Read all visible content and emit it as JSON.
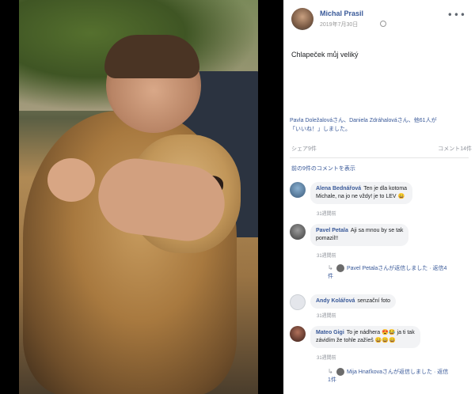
{
  "post": {
    "author": "Michal Prasil",
    "date": "2019年7月30日",
    "more_icon": "more-horizontal-icon",
    "text": "Chlapeček můj veliký",
    "likes_line1": "Pavla Doležalováさん、Daniela Zdráhalováさん、他61人が",
    "likes_line2": "「いいね！」しました。",
    "shares": "シェア9件",
    "comment_count": "コメント14件",
    "prev_comments": "前の9件のコメントを表示"
  },
  "comments": [
    {
      "name": "Alena Bednářová",
      "text_line1": "Ten je dla kotoma",
      "text_line2": "Michale, na jo ne vždy! je to LEV 😀",
      "time": "31週間前"
    },
    {
      "name": "Pavel Petala",
      "text_line1": "Aji sa mnou by se tak",
      "text_line2": "pomazil!!",
      "time": "31週間前",
      "reply": "Pavel Petalaさんが返信しました · 返信4",
      "reply_line2": "件"
    },
    {
      "name": "Andy Kolářová",
      "text_line1": "senzační foto",
      "time": "31週間前"
    },
    {
      "name": "Mateo Gigi",
      "text_line1": "To je nádhera 😍😂 ja ti tak",
      "text_line2": "závidím že tohle zažíeš 😀😀😀",
      "time": "31週間前",
      "reply": "Mija Hnaťkovaさんが返信しました · 返信",
      "reply_line2": "1件"
    }
  ],
  "colors": {
    "link": "#385898",
    "muted": "#90949c",
    "bubble": "#f2f3f5"
  }
}
